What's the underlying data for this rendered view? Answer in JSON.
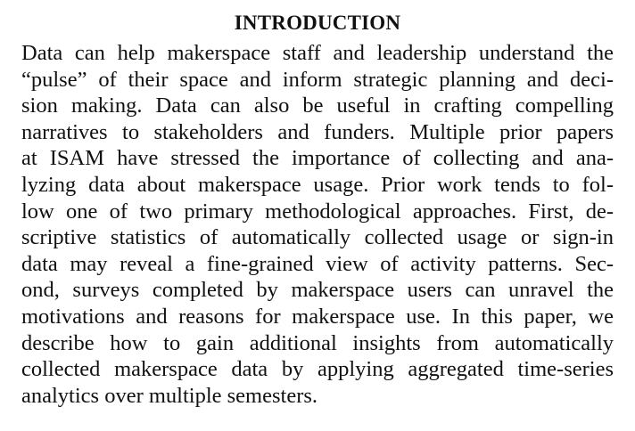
{
  "section": {
    "heading": "INTRODUCTION",
    "lines": [
      "Data can help makerspace staff and leadership understand the",
      "“pulse” of their space and inform strategic planning and deci-",
      "sion making. Data can also be useful in crafting compelling",
      "narratives to stakeholders and funders. Multiple prior papers",
      "at ISAM have stressed the importance of collecting and ana-",
      "lyzing data about makerspace usage. Prior work tends to fol-",
      "low one of two primary methodological approaches. First, de-",
      "scriptive statistics of automatically collected usage or sign-in",
      "data may reveal a fine-grained view of activity patterns. Sec-",
      "ond, surveys completed by makerspace users can unravel the",
      "motivations and reasons for makerspace use. In this paper, we",
      "describe how to gain additional insights from automatically",
      "collected makerspace data by applying aggregated time-series",
      "analytics over multiple semesters."
    ]
  }
}
